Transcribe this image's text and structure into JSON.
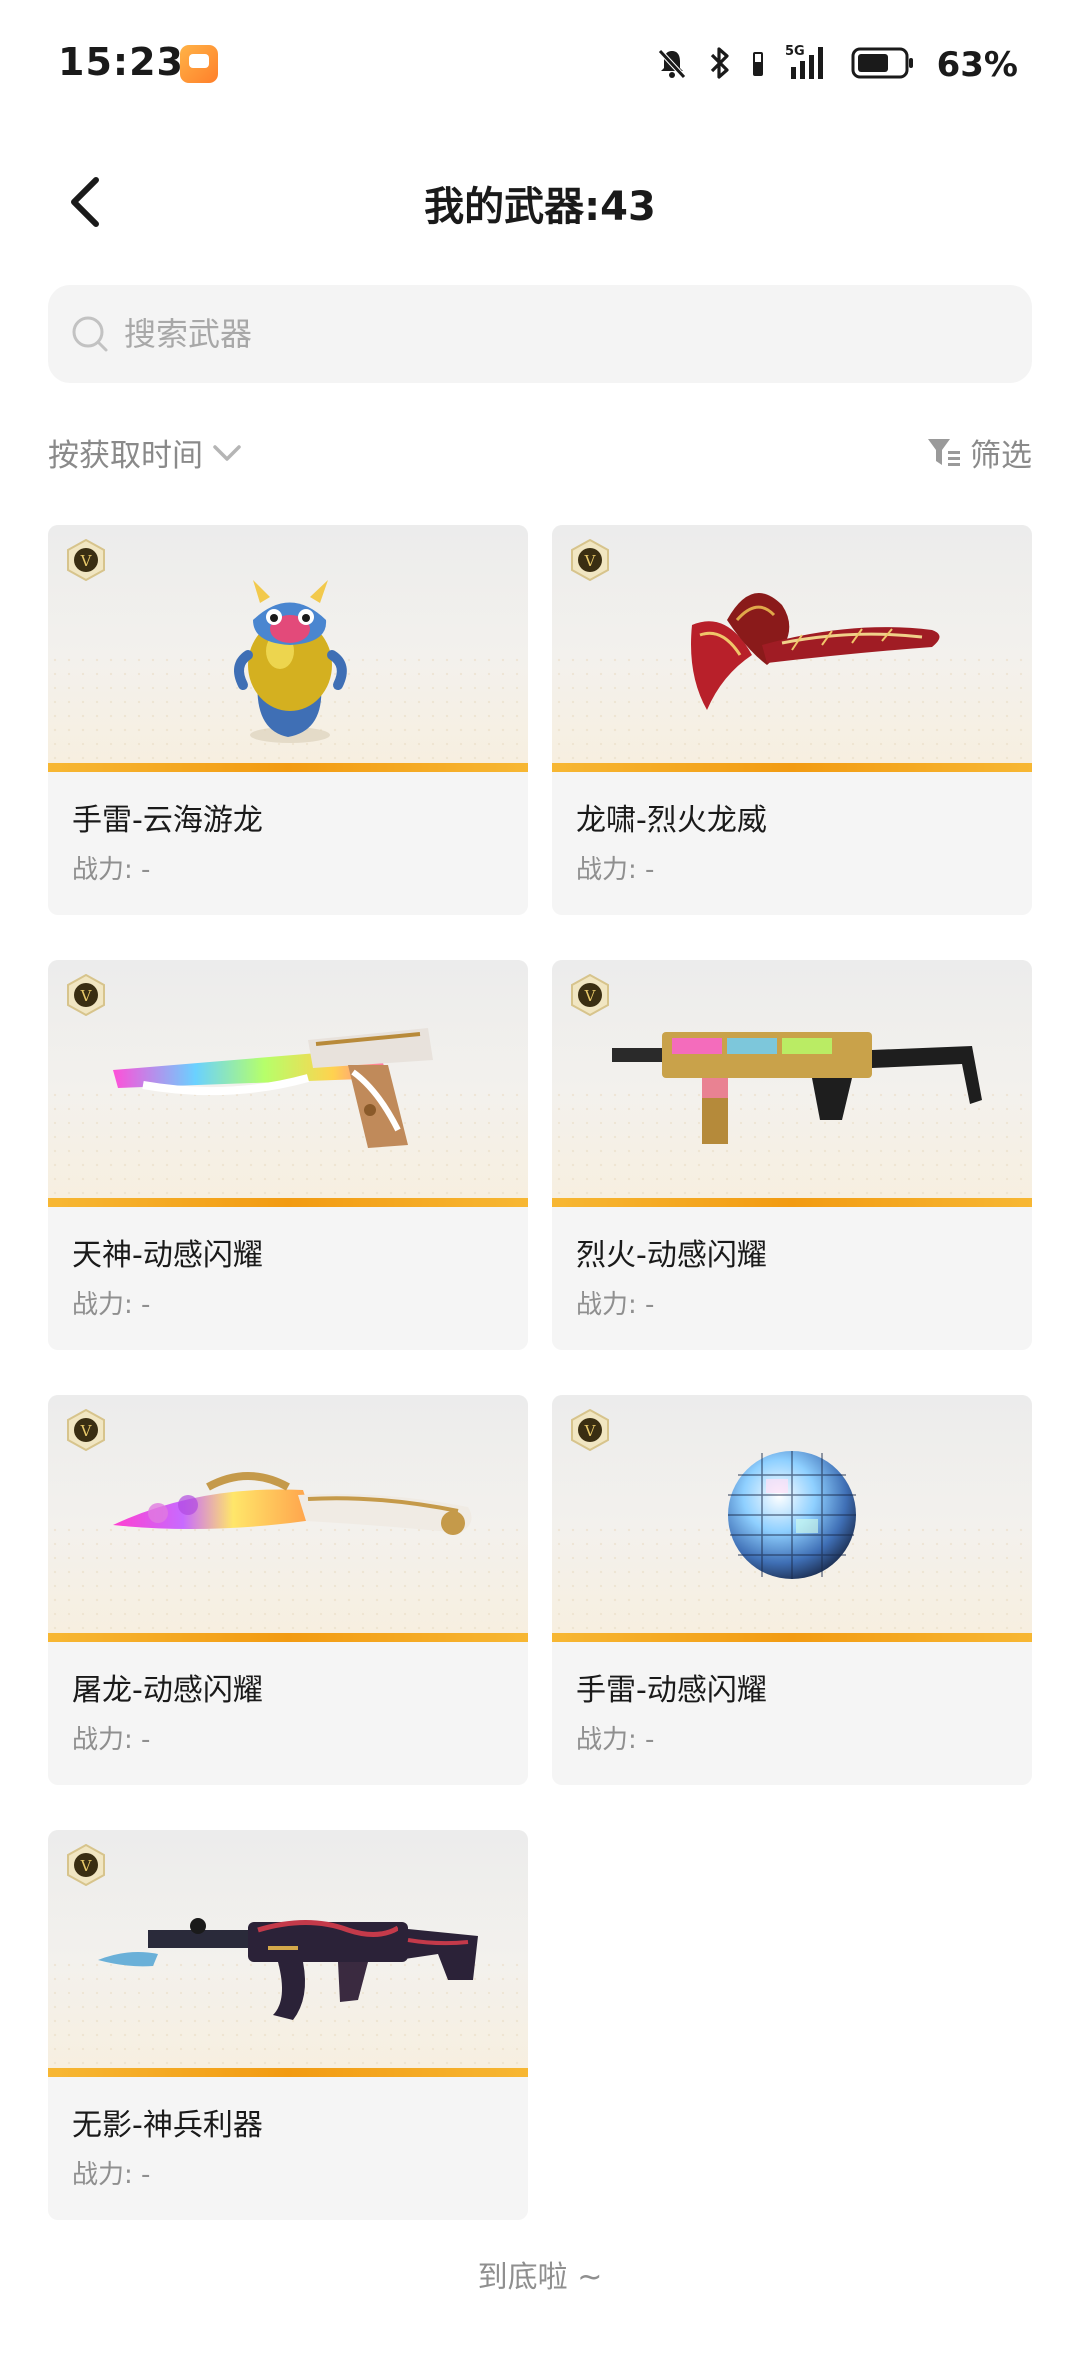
{
  "status_bar": {
    "time": "15:23",
    "network": "5G",
    "battery_percent": "63%"
  },
  "header": {
    "title": "我的武器:43"
  },
  "search": {
    "placeholder": "搜索武器"
  },
  "sort": {
    "label": "按获取时间"
  },
  "filter": {
    "label": "筛选"
  },
  "weapons": [
    {
      "name": "手雷-云海游龙",
      "power": "战力: -",
      "art": "dragon-grenade"
    },
    {
      "name": "龙啸-烈火龙威",
      "power": "战力: -",
      "art": "red-axe"
    },
    {
      "name": "天神-动感闪耀",
      "power": "战力: -",
      "art": "rainbow-pistol"
    },
    {
      "name": "烈火-动感闪耀",
      "power": "战力: -",
      "art": "gold-smg"
    },
    {
      "name": "屠龙-动感闪耀",
      "power": "战力: -",
      "art": "rainbow-knife"
    },
    {
      "name": "手雷-动感闪耀",
      "power": "战力: -",
      "art": "disco-ball"
    },
    {
      "name": "无影-神兵利器",
      "power": "战力: -",
      "art": "dark-rifle"
    }
  ],
  "footer": {
    "end_text": "到底啦 ~"
  },
  "colors": {
    "accent_bar": "#f29b12",
    "card_bg": "#f5f5f5",
    "muted_text": "#8f8f8f"
  }
}
